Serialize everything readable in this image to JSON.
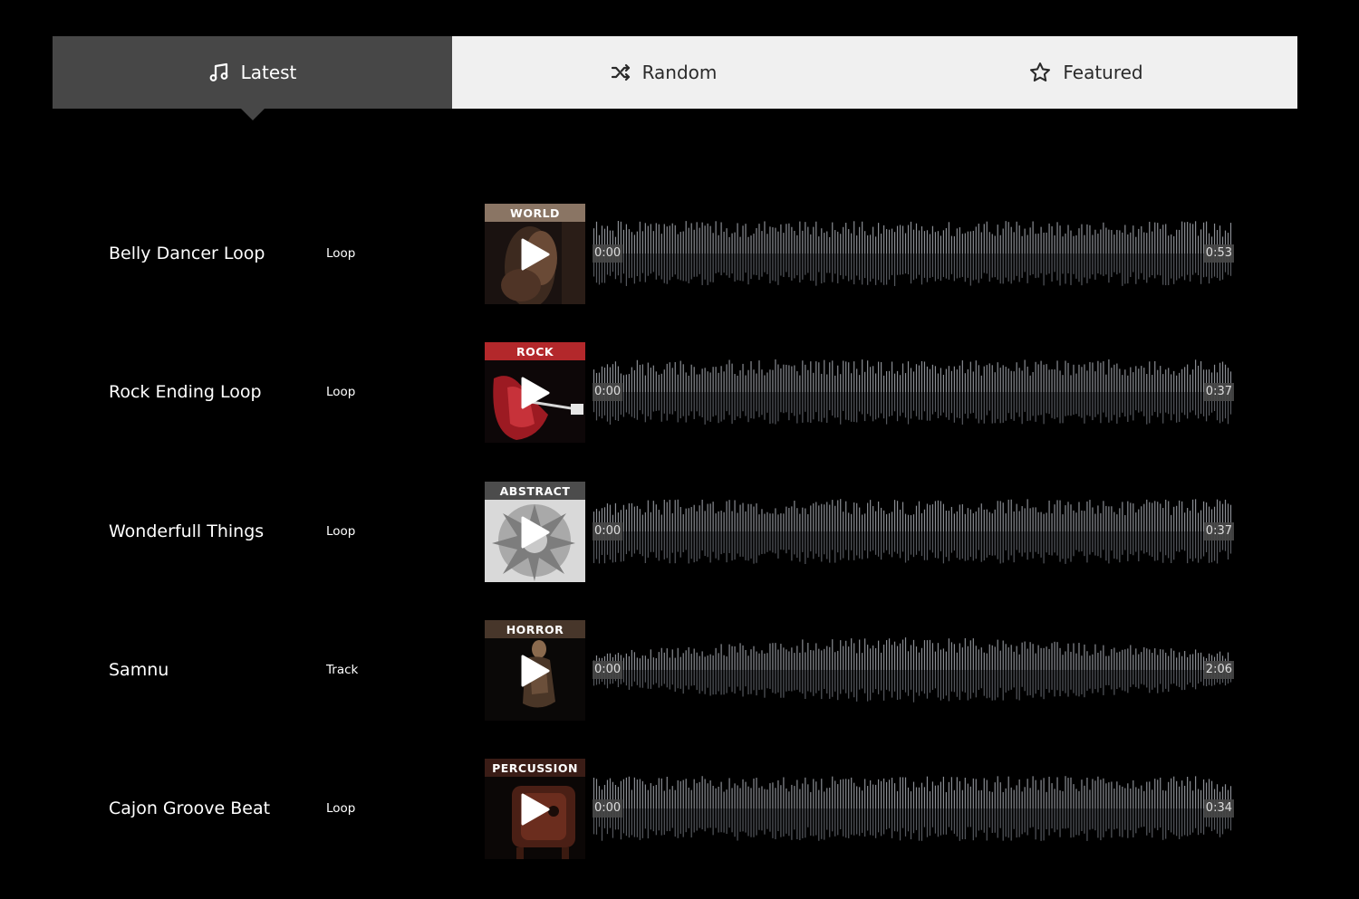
{
  "tabs": [
    {
      "label": "Latest",
      "icon": "music-note-icon",
      "active": true
    },
    {
      "label": "Random",
      "icon": "shuffle-icon",
      "active": false
    },
    {
      "label": "Featured",
      "icon": "star-icon",
      "active": false
    }
  ],
  "tracks": [
    {
      "title": "Belly Dancer Loop",
      "type": "Loop",
      "genre": "WORLD",
      "genre_color": "#8a7564",
      "start": "0:00",
      "duration": "0:53"
    },
    {
      "title": "Rock Ending Loop",
      "type": "Loop",
      "genre": "ROCK",
      "genre_color": "#b3282b",
      "start": "0:00",
      "duration": "0:37"
    },
    {
      "title": "Wonderfull Things",
      "type": "Loop",
      "genre": "ABSTRACT",
      "genre_color": "#4c4c4c",
      "start": "0:00",
      "duration": "0:37"
    },
    {
      "title": "Samnu",
      "type": "Track",
      "genre": "HORROR",
      "genre_color": "#47362a",
      "start": "0:00",
      "duration": "2:06"
    },
    {
      "title": "Cajon Groove Beat",
      "type": "Loop",
      "genre": "PERCUSSION",
      "genre_color": "#3a1c16",
      "start": "0:00",
      "duration": "0:34"
    }
  ]
}
